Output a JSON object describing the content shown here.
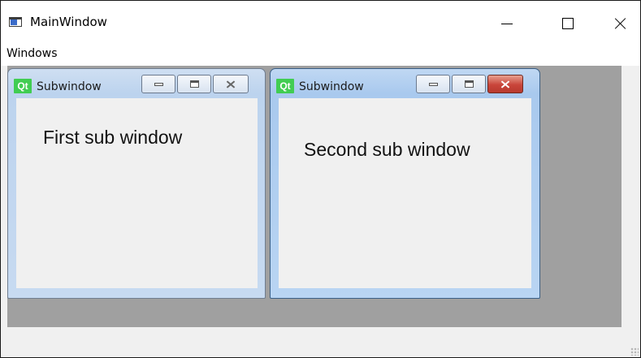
{
  "window": {
    "title": "MainWindow",
    "icon": "app-window-icon",
    "controls": {
      "minimize": "minimize-icon",
      "maximize": "maximize-icon",
      "close": "close-icon"
    }
  },
  "menubar": {
    "items": [
      {
        "label": "Windows"
      }
    ]
  },
  "subwindows": [
    {
      "title": "Subwindow",
      "icon_text": "Qt",
      "content": "First sub window",
      "active": false
    },
    {
      "title": "Subwindow",
      "icon_text": "Qt",
      "content": "Second sub window",
      "active": true
    }
  ],
  "colors": {
    "mdi_background": "#a0a0a0",
    "qt_icon": "#41cd52",
    "active_close": "#c9453a"
  }
}
